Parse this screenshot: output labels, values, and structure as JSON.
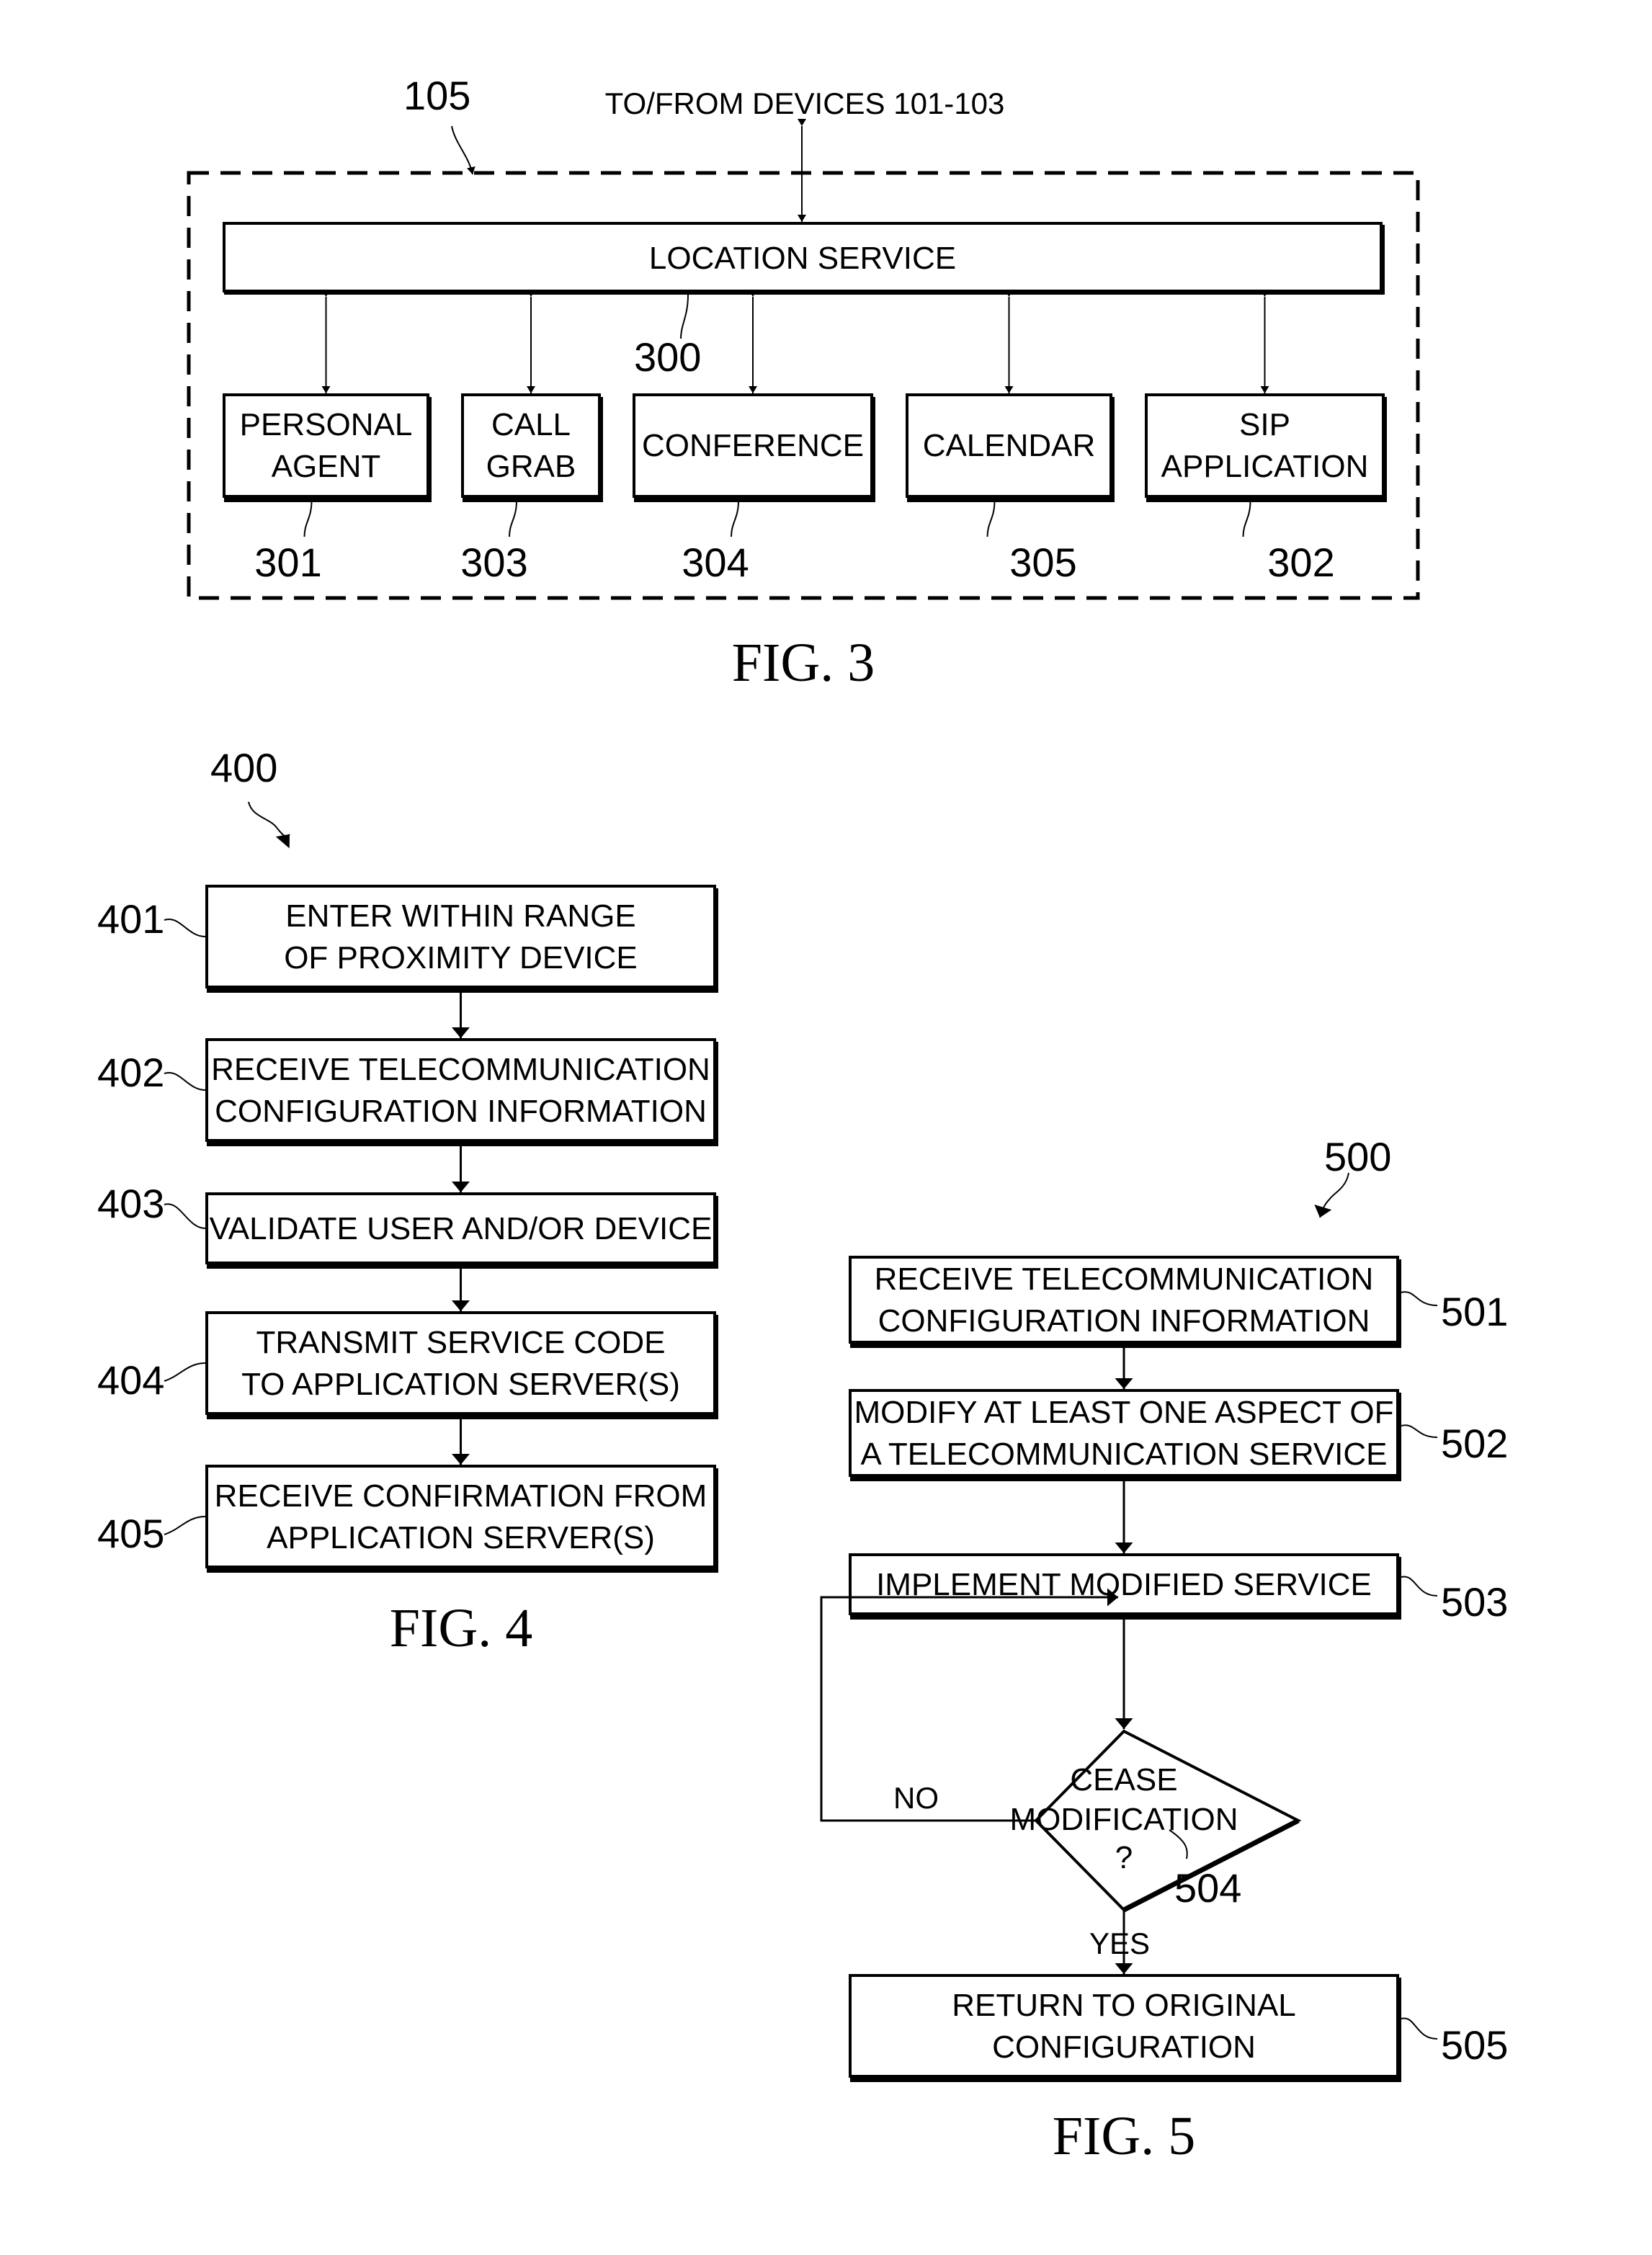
{
  "fig3": {
    "caption": "FIG. 3",
    "ref": "105",
    "external_label": "TO/FROM DEVICES 101-103",
    "location_service": {
      "label": "LOCATION SERVICE",
      "ref": "300"
    },
    "modules": [
      {
        "lines": [
          "PERSONAL",
          "AGENT"
        ],
        "ref": "301"
      },
      {
        "lines": [
          "CALL",
          "GRAB"
        ],
        "ref": "303"
      },
      {
        "lines": [
          "CONFERENCE"
        ],
        "ref": "304"
      },
      {
        "lines": [
          "CALENDAR"
        ],
        "ref": "305"
      },
      {
        "lines": [
          "SIP",
          "APPLICATION"
        ],
        "ref": "302"
      }
    ]
  },
  "fig4": {
    "caption": "FIG. 4",
    "ref": "400",
    "steps": [
      {
        "ref": "401",
        "lines": [
          "ENTER WITHIN RANGE",
          "OF PROXIMITY DEVICE"
        ]
      },
      {
        "ref": "402",
        "lines": [
          "RECEIVE TELECOMMUNICATION",
          "CONFIGURATION INFORMATION"
        ]
      },
      {
        "ref": "403",
        "lines": [
          "VALIDATE USER AND/OR DEVICE"
        ]
      },
      {
        "ref": "404",
        "lines": [
          "TRANSMIT SERVICE CODE",
          "TO APPLICATION SERVER(S)"
        ]
      },
      {
        "ref": "405",
        "lines": [
          "RECEIVE CONFIRMATION FROM",
          "APPLICATION SERVER(S)"
        ]
      }
    ]
  },
  "fig5": {
    "caption": "FIG. 5",
    "ref": "500",
    "steps": [
      {
        "ref": "501",
        "lines": [
          "RECEIVE TELECOMMUNICATION",
          "CONFIGURATION INFORMATION"
        ]
      },
      {
        "ref": "502",
        "lines": [
          "MODIFY AT LEAST ONE ASPECT OF",
          "A TELECOMMUNICATION SERVICE"
        ]
      },
      {
        "ref": "503",
        "lines": [
          "IMPLEMENT MODIFIED SERVICE"
        ]
      },
      {
        "ref": "505",
        "lines": [
          "RETURN TO ORIGINAL",
          "CONFIGURATION"
        ]
      }
    ],
    "decision": {
      "ref": "504",
      "lines": [
        "CEASE",
        "MODIFICATION",
        "?"
      ],
      "no_label": "NO",
      "yes_label": "YES"
    }
  }
}
